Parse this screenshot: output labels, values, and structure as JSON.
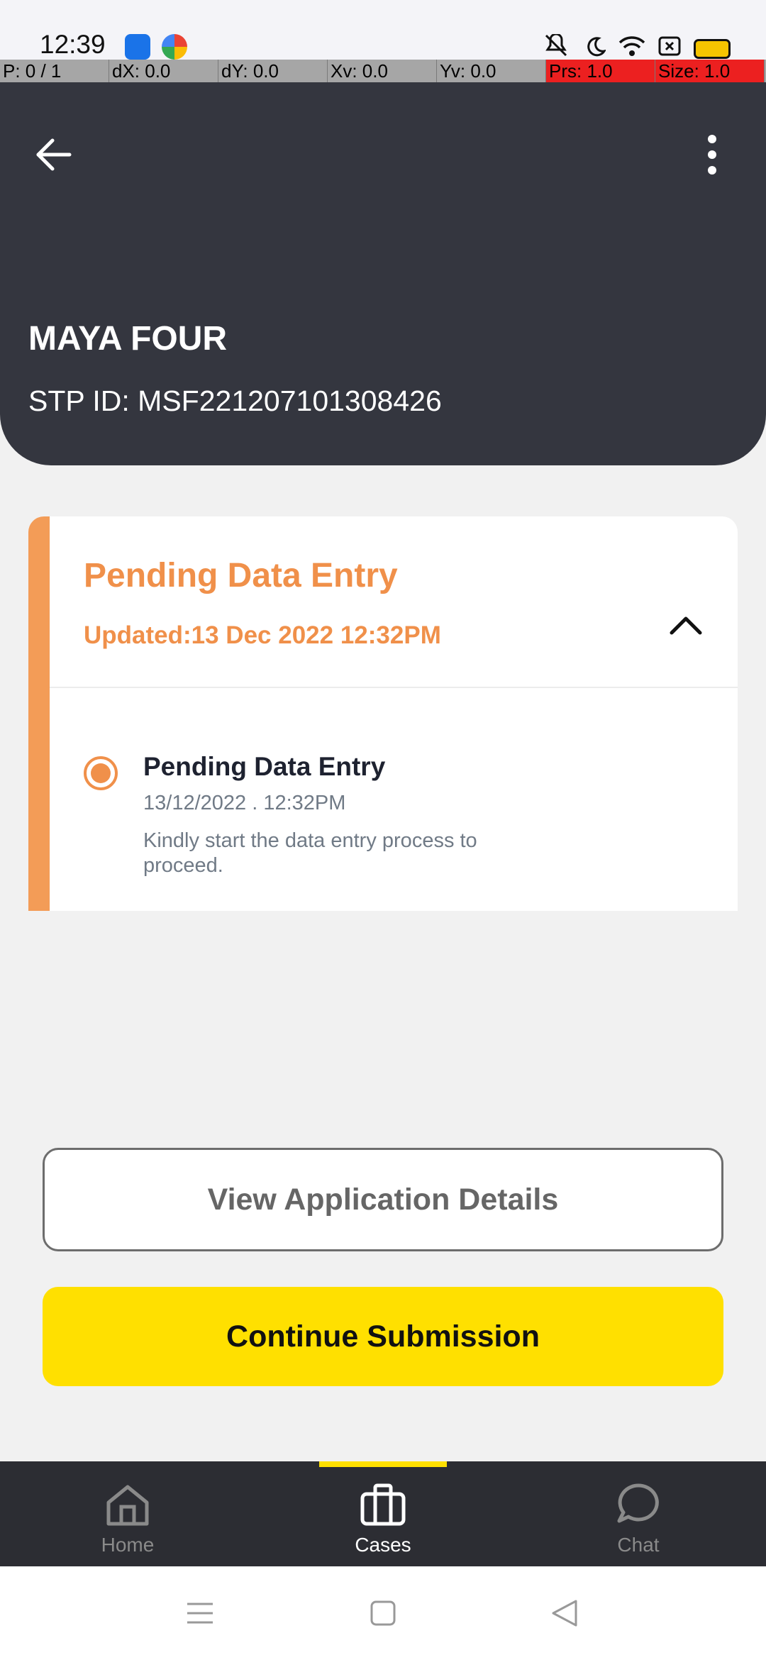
{
  "status_bar": {
    "time": "12:39",
    "icons": [
      "android-app-icon",
      "browser-app-icon",
      "mute-icon",
      "moon-icon",
      "wifi-icon",
      "sim-icon",
      "battery-icon"
    ]
  },
  "pointer_overlay": {
    "p": "P: 0 / 1",
    "dx": "dX: 0.0",
    "dy": "dY: 0.0",
    "xv": "Xv: 0.0",
    "yv": "Yv: 0.0",
    "prs": "Prs: 1.0",
    "size": "Size: 1.0"
  },
  "header": {
    "name": "MAYA FOUR",
    "stp_id": "STP ID: MSF221207101308426",
    "back_icon": "arrow-left-icon",
    "more_icon": "more-vertical-icon"
  },
  "status_card": {
    "title": "Pending Data Entry",
    "updated": "Updated:13 Dec 2022 12:32PM",
    "accent_color": "#f39c57",
    "timeline": [
      {
        "title": "Pending Data Entry",
        "time": "13/12/2022 . 12:32PM",
        "description": "Kindly start the data entry process to proceed."
      }
    ]
  },
  "actions": {
    "view_label": "View Application Details",
    "continue_label": "Continue Submission",
    "continue_color": "#ffe000"
  },
  "bottom_nav": {
    "items": [
      {
        "label": "Home",
        "icon": "home-icon",
        "active": false
      },
      {
        "label": "Cases",
        "icon": "briefcase-icon",
        "active": true
      },
      {
        "label": "Chat",
        "icon": "chat-icon",
        "active": false
      }
    ]
  }
}
